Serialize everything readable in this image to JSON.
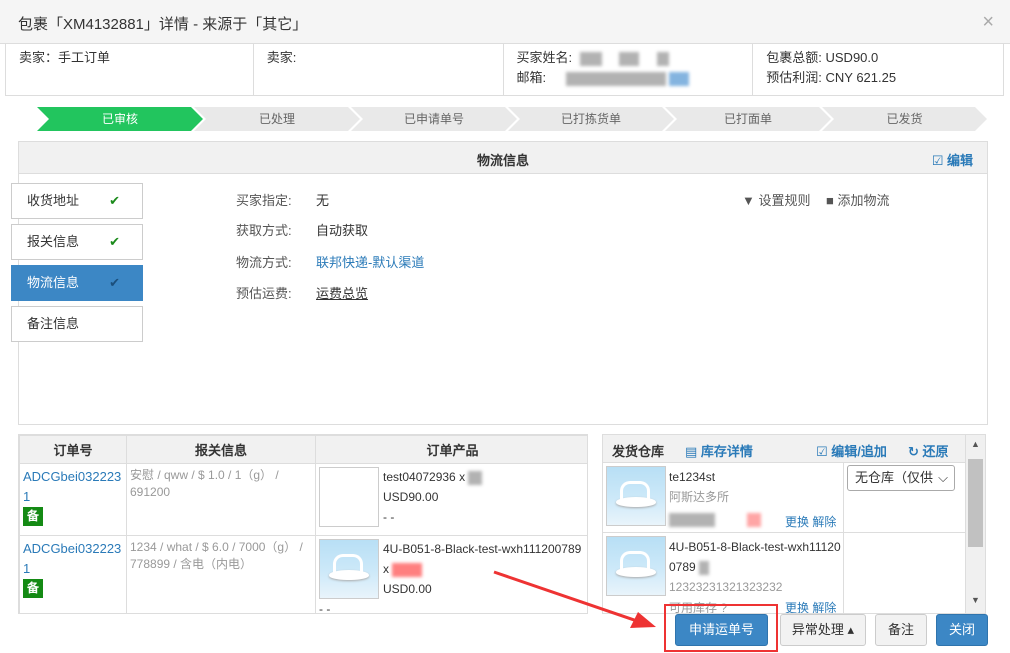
{
  "header": {
    "title": "包裹「XM4132881」详情 - 来源于「其它」",
    "close": "×"
  },
  "info": {
    "seller": "卖家：手工订单",
    "buyer": "卖家:",
    "buyer_name_label": "买家姓名:",
    "email_label": "邮箱:",
    "total_label": "包裹总额:",
    "total_value": "USD90.0",
    "profit_label": "预估利润:",
    "profit_value": "CNY 621.25"
  },
  "steps": [
    "已审核",
    "已处理",
    "已申请单号",
    "已打拣货单",
    "已打面单",
    "已发货"
  ],
  "logistics_panel": {
    "title": "物流信息",
    "edit": "编辑",
    "fields": [
      {
        "label": "买家指定:",
        "value": "无"
      },
      {
        "label": "获取方式:",
        "value": "自动获取"
      },
      {
        "label": "物流方式:",
        "value": "联邦快递-默认渠道"
      },
      {
        "label": "预估运费:",
        "value": "运费总览"
      }
    ],
    "set_rule": "设置规则",
    "add_logistics": "添加物流"
  },
  "tabs": [
    {
      "label": "收货地址",
      "check": "✔"
    },
    {
      "label": "报关信息",
      "check": "✔"
    },
    {
      "label": "物流信息",
      "check": "✔"
    },
    {
      "label": "备注信息",
      "check": ""
    }
  ],
  "orders": {
    "headers": [
      "订单号",
      "报关信息",
      "订单产品"
    ],
    "rows": [
      {
        "order_no": "ADCGbei0322231",
        "badge": "备",
        "customs": "安慰 / qww / $ 1.0 / 1（g） / 691200",
        "sku": "test04072936 x",
        "price": "USD90.00",
        "dash": "- -"
      },
      {
        "order_no": "ADCGbei0322231",
        "badge": "备",
        "customs": "1234 / what / $ 6.0 / 7000（g） / 778899 / 含电（内电）",
        "sku": "4U-B051-8-Black-test-wxh111200789 x",
        "price": "USD0.00",
        "dash": "- -"
      }
    ]
  },
  "warehouse": {
    "title": "发货仓库",
    "stock_detail": "库存详情",
    "edit_add": "编辑/追加",
    "restore": "还原",
    "select_value": "无仓库（仅供",
    "items": [
      {
        "sku": "te1234st",
        "name": "阿斯达多所",
        "replace": "更换",
        "unbind": "解除"
      },
      {
        "sku": "4U-B051-8-Black-test-wxh111200789",
        "name": "12323231321323232",
        "stock": "可用库存",
        "replace": "更换",
        "unbind": "解除"
      }
    ]
  },
  "buttons": {
    "apply_tracking": "申请运单号",
    "exception": "异常处理",
    "note": "备注",
    "close": "关闭"
  },
  "colors": {
    "accent": "#3c87c5",
    "active_step": "#22c55e",
    "highlight": "#ee3333",
    "badge": "#148a14"
  }
}
